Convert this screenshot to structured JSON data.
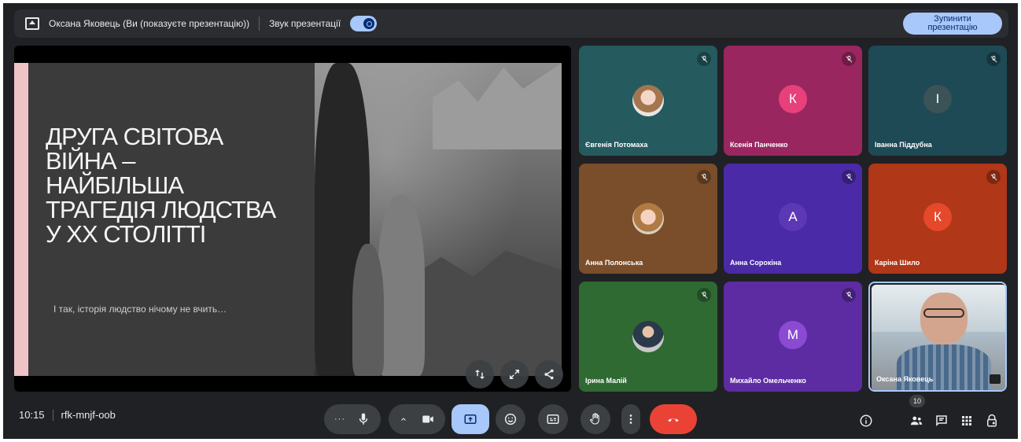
{
  "presenting_bar": {
    "presenter_text": "Оксана Яковець (Ви (показуєте презентацію))",
    "audio_label": "Звук презентації",
    "audio_toggle_on": true,
    "stop_button_line1": "Зупинити",
    "stop_button_line2": "презентацію"
  },
  "slide": {
    "title_lines": [
      "Друга світова",
      "війна –",
      "найбільша",
      "трагедія людства",
      "у XX столітті"
    ],
    "subtitle": "І так, історія людство нічому не вчить…"
  },
  "participants": [
    {
      "name": "Євгенія Потомаха",
      "type": "photo",
      "bg": "#255a5f",
      "mic": "muted"
    },
    {
      "name": "Ксенія Панченко",
      "type": "letter",
      "letter": "К",
      "avatar_color": "#e8407b",
      "bg": "#9a2660",
      "mic": "muted"
    },
    {
      "name": "Іванна Піддубна",
      "type": "letter",
      "letter": "І",
      "avatar_color": "#3b5357",
      "bg": "#1e4a55",
      "mic": "muted"
    },
    {
      "name": "Анна Полонська",
      "type": "photo",
      "bg": "#7a4e2a",
      "mic": "muted"
    },
    {
      "name": "Анна Сорокіна",
      "type": "letter",
      "letter": "А",
      "avatar_color": "#5c38b4",
      "bg": "#4a2aa6",
      "mic": "muted"
    },
    {
      "name": "Каріна Шило",
      "type": "letter",
      "letter": "К",
      "avatar_color": "#e5482a",
      "bg": "#b03718",
      "mic": "muted"
    },
    {
      "name": "Ірина Малій",
      "type": "photo",
      "bg": "#2f6a33",
      "mic": "muted"
    },
    {
      "name": "Михайло Омельченко",
      "type": "letter",
      "letter": "М",
      "avatar_color": "#8a4bd2",
      "bg": "#5d2ca3",
      "mic": "muted"
    },
    {
      "name": "Оксана Яковець",
      "type": "self_video",
      "bg": "#c9d3da",
      "mic": "on"
    }
  ],
  "bottom_bar": {
    "time": "10:15",
    "meeting_code": "rfk-mnjf-oob",
    "more_glyph": "···",
    "participant_count": "10"
  },
  "icons": {
    "presenting": "present-to-all-icon",
    "mic": "mic-icon",
    "camera": "videocam-icon",
    "present": "present-to-all-icon",
    "emoji": "emoji-icon",
    "captions": "captions-icon",
    "raise_hand": "raise-hand-icon",
    "more": "more-vert-icon",
    "leave": "call-end-icon",
    "info": "info-icon",
    "people": "people-icon",
    "chat": "chat-icon",
    "activities": "apps-icon",
    "host_controls": "lock-person-icon"
  },
  "colors": {
    "accent": "#a8c7fa",
    "leave_red": "#ea4335",
    "control_bg": "#3c4043",
    "background": "#202124"
  }
}
